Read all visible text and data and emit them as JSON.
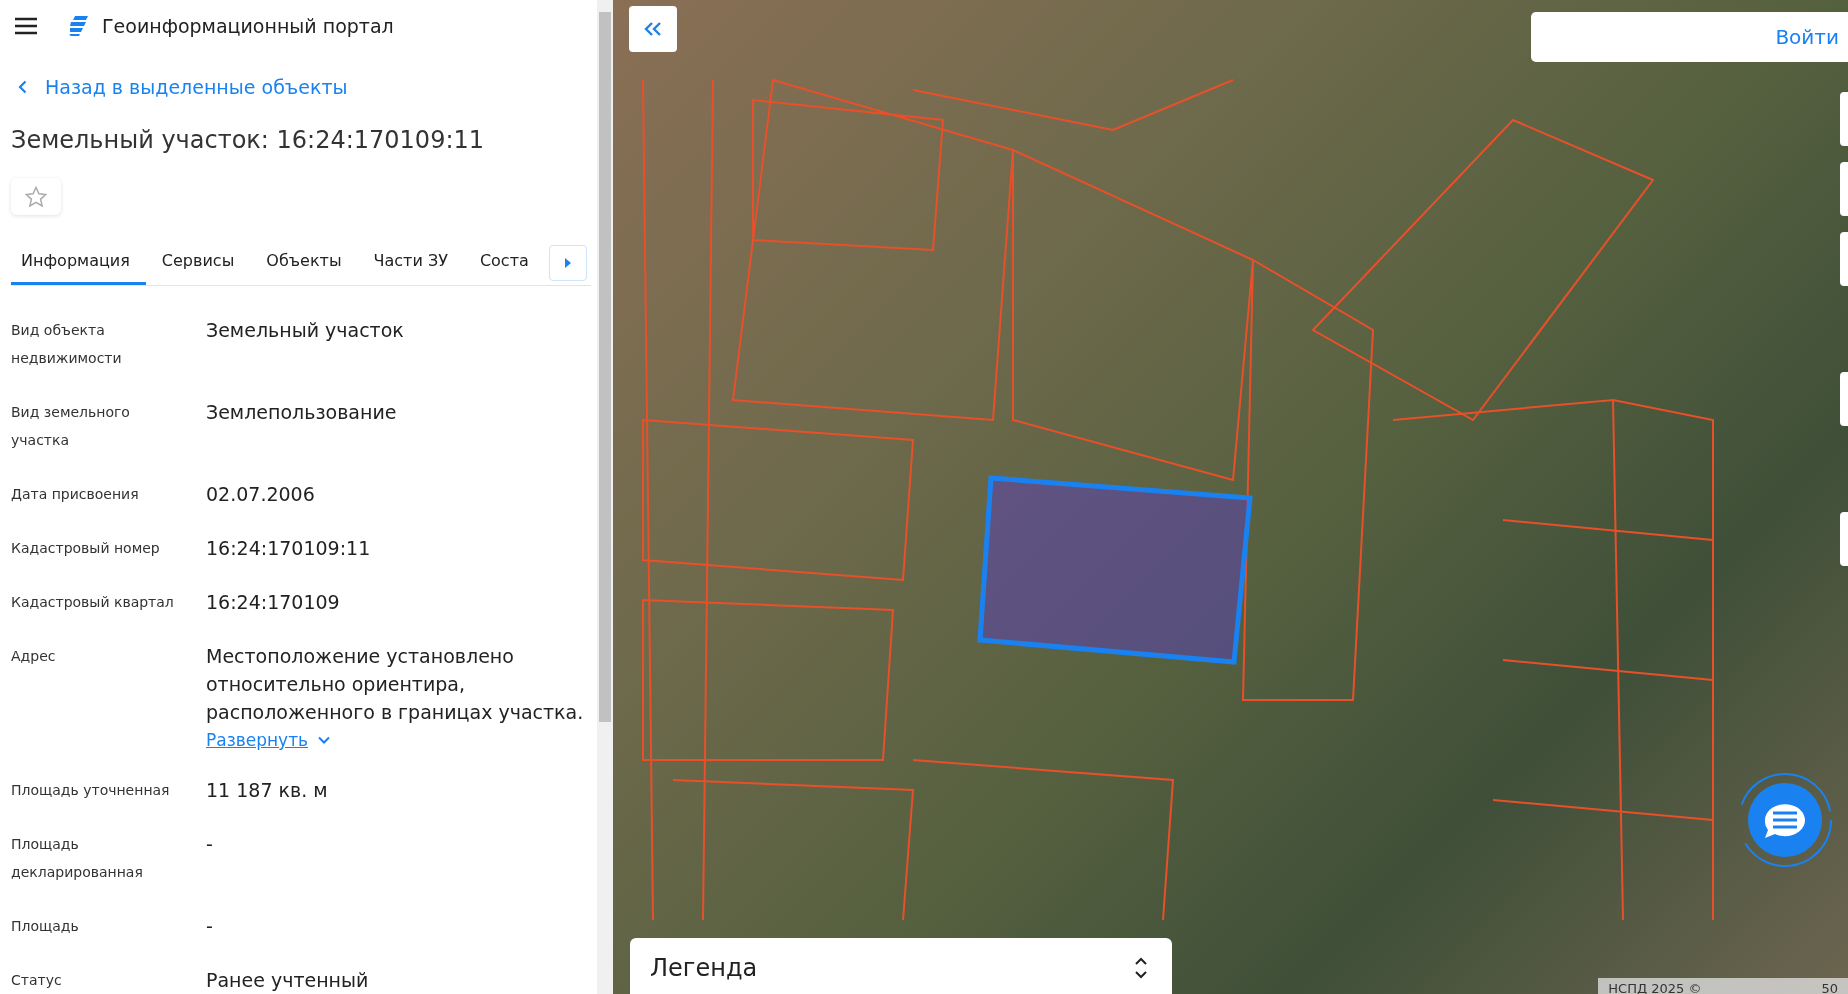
{
  "header": {
    "title": "Геоинформационный портал"
  },
  "back_link": {
    "label": "Назад в выделенные объекты"
  },
  "object": {
    "title": "Земельный участок: 16:24:170109:11",
    "favorite": false
  },
  "tabs": [
    {
      "label": "Информация",
      "selected": true
    },
    {
      "label": "Сервисы",
      "selected": false
    },
    {
      "label": "Объекты",
      "selected": false
    },
    {
      "label": "Части ЗУ",
      "selected": false
    },
    {
      "label": "Соста",
      "selected": false
    }
  ],
  "properties": [
    {
      "label": "Вид объекта недвижимости",
      "value": "Земельный участок"
    },
    {
      "label": "Вид земельного участка",
      "value": "Землепользование"
    },
    {
      "label": "Дата присвоения",
      "value": "02.07.2006"
    },
    {
      "label": "Кадастровый номер",
      "value": "16:24:170109:11"
    },
    {
      "label": "Кадастровый квартал",
      "value": "16:24:170109"
    },
    {
      "label": "Адрес",
      "value": "Местоположение установлено относительно ориентира, расположенного в границах участка.",
      "expand_link": "Развернуть"
    },
    {
      "label": "Площадь уточненная",
      "value": "11 187 кв. м"
    },
    {
      "label": "Площадь декларированная",
      "value": "-"
    },
    {
      "label": "Площадь",
      "value": "-"
    },
    {
      "label": "Статус",
      "value": "Ранее учтенный"
    }
  ],
  "map": {
    "login_button": "Войти",
    "legend": {
      "title": "Легенда"
    },
    "attribution": "НСПД 2025 ©",
    "scale": "50"
  }
}
